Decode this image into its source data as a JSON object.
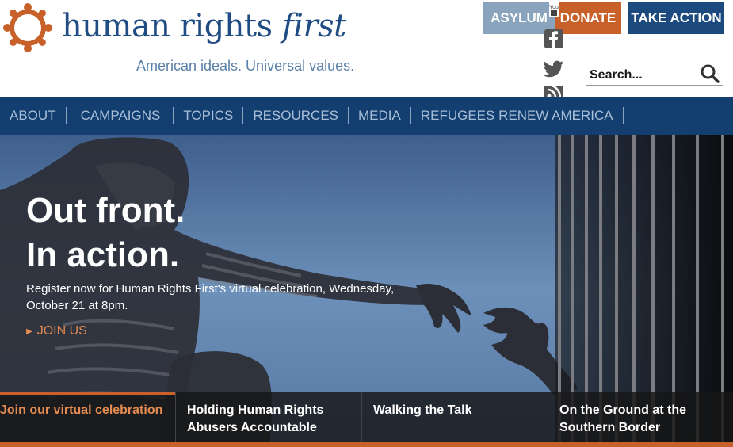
{
  "brand": {
    "name_main": "human rights ",
    "name_em": "first",
    "tagline": "American ideals. Universal values."
  },
  "header": {
    "buttons": {
      "asylum": "ASYLUM",
      "donate": "DONATE",
      "take_action": "TAKE ACTION"
    },
    "social": [
      "youtube-icon",
      "facebook-icon",
      "twitter-icon",
      "rss-icon"
    ],
    "search": {
      "placeholder": "Search..."
    }
  },
  "nav": {
    "items": [
      "ABOUT",
      "CAMPAIGNS",
      "TOPICS",
      "RESOURCES",
      "MEDIA",
      "REFUGEES RENEW AMERICA"
    ]
  },
  "hero": {
    "title_line1": "Out front.",
    "title_line2": "In action.",
    "subtitle": "Register now for Human Rights First's virtual celebration, Wednesday, October 21 at 8pm.",
    "cta": "JOIN US"
  },
  "tabs": [
    {
      "label": "Join our virtual celebration",
      "active": true
    },
    {
      "label": "Holding Human Rights Abusers Accountable",
      "active": false
    },
    {
      "label": "Walking the Talk",
      "active": false
    },
    {
      "label": "On the Ground at the Southern Border",
      "active": false
    }
  ],
  "colors": {
    "brand_blue": "#1f4c82",
    "nav_blue": "#123e70",
    "accent_orange": "#c8602a",
    "asylum_gray_blue": "#8aa4bd"
  }
}
